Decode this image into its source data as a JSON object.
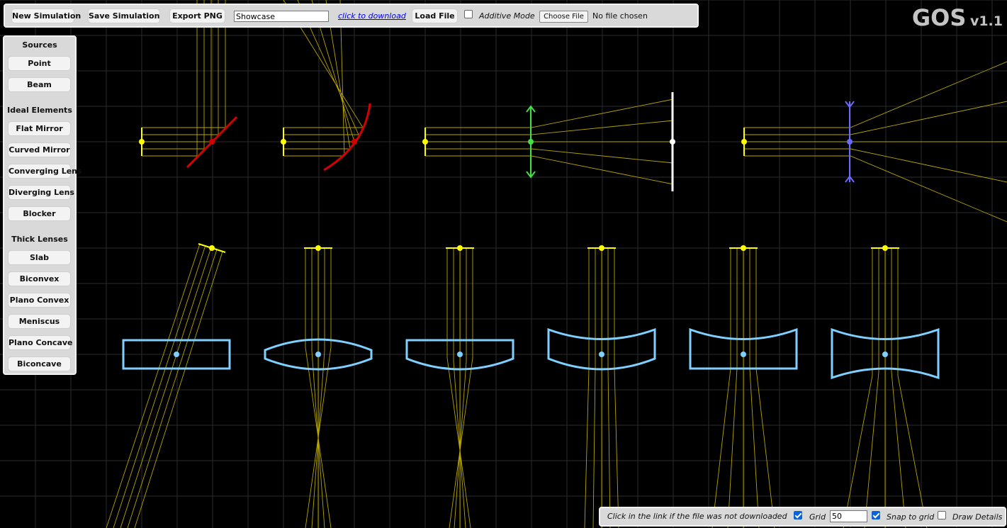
{
  "toolbar": {
    "new_simulation": "New Simulation",
    "save_simulation": "Save Simulation",
    "export_png": "Export PNG",
    "filename_value": "Showcase",
    "download_link": "click to download",
    "load_file": "Load File",
    "additive_mode_label": "Additive Mode",
    "additive_mode_checked": false,
    "choose_file": "Choose File",
    "no_file_chosen": "No file chosen"
  },
  "brand": {
    "name": "GOS",
    "version": "v1.1"
  },
  "sidebar": {
    "sources_heading": "Sources",
    "sources": [
      "Point",
      "Beam"
    ],
    "ideal_heading": "Ideal Elements",
    "ideal": [
      "Flat Mirror",
      "Curved Mirror",
      "Converging Lens",
      "Diverging Lens",
      "Blocker"
    ],
    "thick_heading": "Thick Lenses",
    "thick": [
      "Slab",
      "Biconvex",
      "Plano Convex",
      "Meniscus",
      "Plano Concave",
      "Biconcave"
    ]
  },
  "statusbar": {
    "hint": "Click in the link if the file was not downloaded",
    "grid_label": "Grid",
    "grid_checked": true,
    "grid_size": "50",
    "snap_label": "Snap to grid",
    "snap_checked": true,
    "draw_details_label": "Draw Details",
    "draw_details_checked": false
  },
  "colors": {
    "background": "#000000",
    "grid": "#2b2b2b",
    "ray": "#b7a400",
    "source": "#ffff00",
    "mirror": "#d40000",
    "converging_lens": "#44dd44",
    "diverging_lens": "#6a6aff",
    "blocker": "#ffffff",
    "thick_lens": "#7fcfff"
  }
}
